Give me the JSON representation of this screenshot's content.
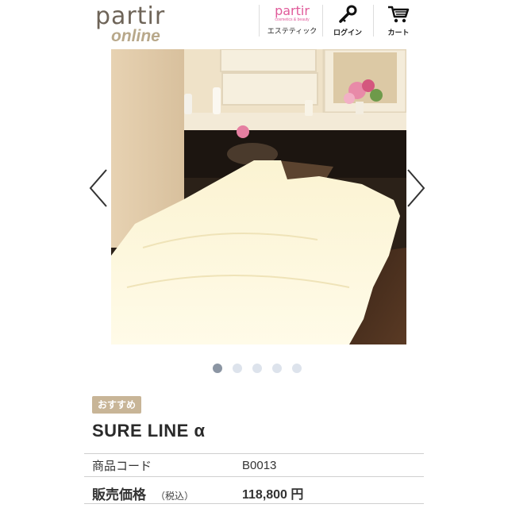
{
  "header": {
    "logo_top": "partir",
    "logo_bottom": "online",
    "esthe_logo": "partir",
    "esthe_sub": "cosmetics & beauty",
    "esthe_label": "エステティック",
    "login_label": "ログイン",
    "cart_label": "カート",
    "icons": [
      "key-icon",
      "cart-icon",
      "chevron-left-icon",
      "chevron-right-icon"
    ]
  },
  "carousel": {
    "slide_count": 5,
    "active_index": 0
  },
  "product": {
    "badge": "おすすめ",
    "name": "SURE LINE α",
    "code_label": "商品コード",
    "code_value": "B0013",
    "price_label": "販売価格",
    "tax_label": "（税込）",
    "price_value": "118,800 円"
  },
  "colors": {
    "badge": "#c8b597",
    "esthe_pink": "#e05a9a",
    "dot_active": "#8b95a3",
    "dot_inactive": "#dde3ec"
  }
}
